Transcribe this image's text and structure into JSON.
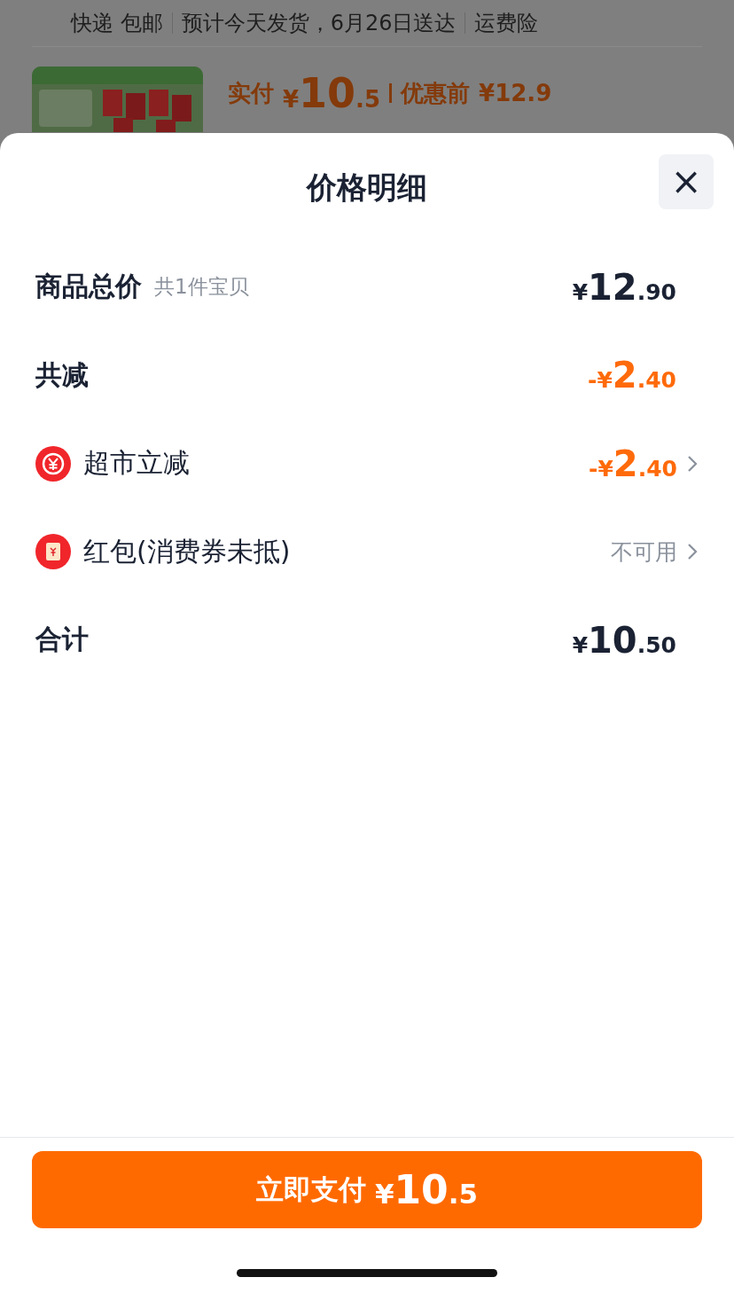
{
  "background": {
    "shipping": [
      "快递 包邮",
      "预计今天发货，6月26日送达",
      "运费险"
    ],
    "product": {
      "paid_label": "实付",
      "paid": "¥10.5",
      "original_label": "优惠前",
      "original": "¥12.9"
    }
  },
  "sheet": {
    "title": "价格明细",
    "close": "×",
    "rows": [
      {
        "kind": "sum",
        "label": "商品总价",
        "note": "共1件宝贝",
        "amount": "¥12.90",
        "chevron": false
      },
      {
        "kind": "reduction",
        "label": "共减",
        "amount": "-¥2.40",
        "chevron": false
      },
      {
        "kind": "discount",
        "label": "超市立减",
        "amount": "-¥2.40",
        "chevron": true
      },
      {
        "kind": "coupon",
        "label": "红包(消费券未抵)",
        "amount": "不可用",
        "chevron": true
      },
      {
        "kind": "sum",
        "label": "合计",
        "amount": "¥10.50",
        "chevron": false
      }
    ],
    "pay_button": {
      "label": "立即支付",
      "amount": "¥10.5"
    }
  }
}
